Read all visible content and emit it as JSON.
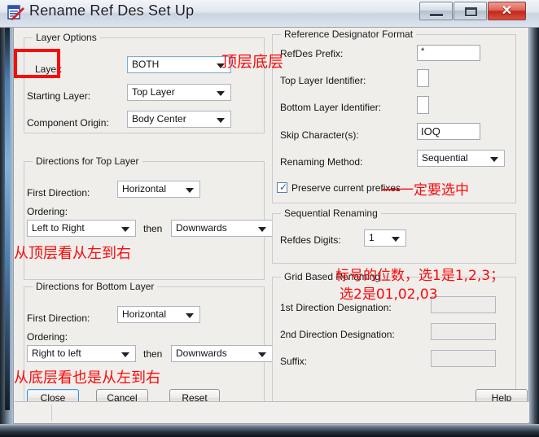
{
  "window": {
    "title": "Rename Ref Des Set Up",
    "icon": "rename-refdes-icon",
    "minimize_label": "",
    "maximize_label": "",
    "close_label": "✕"
  },
  "layer_options": {
    "group_label": "Layer Options",
    "layer_label": "Layer:",
    "layer_value": "BOTH",
    "starting_layer_label": "Starting Layer:",
    "starting_layer_value": "Top Layer",
    "component_origin_label": "Component Origin:",
    "component_origin_value": "Body Center"
  },
  "top_directions": {
    "group_label": "Directions for Top Layer",
    "first_direction_label": "First Direction:",
    "first_direction_value": "Horizontal",
    "ordering_label": "Ordering:",
    "ordering_value": "Left to Right",
    "then_label": "then",
    "ordering2_value": "Downwards"
  },
  "bottom_directions": {
    "group_label": "Directions for Bottom Layer",
    "first_direction_label": "First Direction:",
    "first_direction_value": "Horizontal",
    "ordering_label": "Ordering:",
    "ordering_value": "Right to left",
    "then_label": "then",
    "ordering2_value": "Downwards"
  },
  "refdes_format": {
    "group_label": "Reference Designator Format",
    "prefix_label": "RefDes Prefix:",
    "prefix_value": "*",
    "top_identifier_label": "Top Layer Identifier:",
    "top_identifier_value": "",
    "bottom_identifier_label": "Bottom Layer Identifier:",
    "bottom_identifier_value": "",
    "skip_characters_label": "Skip Character(s):",
    "skip_characters_value": "IOQ",
    "renaming_method_label": "Renaming Method:",
    "renaming_method_value": "Sequential",
    "preserve_prefixes_label": "Preserve current prefixes",
    "preserve_prefixes_checked": "✓"
  },
  "sequential_renaming": {
    "group_label": "Sequential Renaming",
    "refdes_digits_label": "Refdes Digits:",
    "refdes_digits_value": "1"
  },
  "grid_renaming": {
    "group_label": "Grid Based Renaming",
    "first_designation_label": "1st Direction Designation:",
    "first_designation_value": "",
    "second_designation_label": "2nd Direction Designation:",
    "second_designation_value": "",
    "suffix_label": "Suffix:",
    "suffix_value": ""
  },
  "buttons": {
    "close": "Close",
    "cancel": "Cancel",
    "reset": "Reset",
    "help": "Help"
  },
  "annotations": {
    "layer_note": "顶层底层",
    "top_layer_note": "从顶层看从左到右",
    "bottom_layer_note": "从底层看也是从左到右",
    "preserve_note": "一定要选中",
    "digits_note_line1": "标号的位数，选1是1,2,3；",
    "digits_note_line2": "选2是01,02,03"
  },
  "colors": {
    "annotation_red": "#fa0a0a",
    "highlight_box": "#f80b0b",
    "dialog_bg": "#f0eeeb",
    "focus_blue": "#3c93d4"
  }
}
